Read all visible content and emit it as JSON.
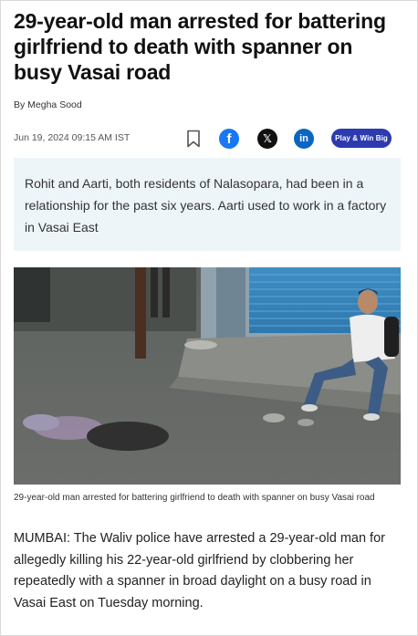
{
  "article": {
    "headline": "29-year-old man arrested for battering girlfriend to death with spanner on busy Vasai road",
    "byline": "By Megha Sood",
    "date": "Jun 19, 2024 09:15 AM IST",
    "summary": "Rohit and Aarti, both residents of Nalasopara, had been in a relationship for the past six years. Aarti used to work in a factory in Vasai East",
    "image_caption": "29-year-old man arrested for battering girlfriend to death with spanner on busy Vasai road",
    "body": "MUMBAI: The Waliv police have arrested a 29-year-old man for allegedly killing his 22-year-old girlfriend by clobbering her repeatedly with a spanner in broad daylight on a busy road in Vasai East on Tuesday morning."
  },
  "share": {
    "bookmark_icon": "bookmark-icon",
    "facebook_icon": "facebook-icon",
    "facebook_glyph": "f",
    "x_icon": "x-icon",
    "x_glyph": "𝕏",
    "linkedin_icon": "linkedin-icon",
    "linkedin_glyph": "in",
    "play_label": "Play & Win Big"
  },
  "colors": {
    "facebook": "#1877f2",
    "x": "#111111",
    "linkedin": "#0a66c2",
    "play_button": "#2d3bb0",
    "summary_bg": "#eef5f8"
  }
}
